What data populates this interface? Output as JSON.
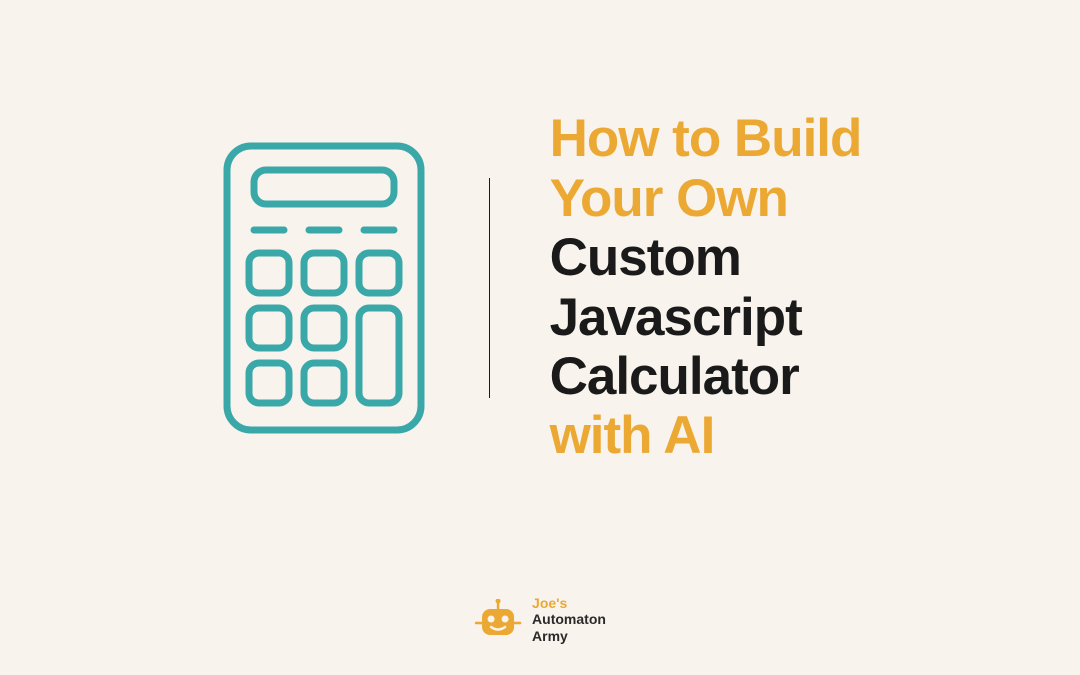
{
  "title": {
    "line1": "How to Build",
    "line2": "Your Own",
    "line3": " Custom",
    "line4": "Javascript",
    "line5": "Calculator",
    "line6": " with AI"
  },
  "logo": {
    "line1": "Joe's",
    "line2": "Automaton",
    "line3": "Army"
  },
  "colors": {
    "orange": "#eba833",
    "teal": "#3aa8a8",
    "black": "#1a1a1a",
    "background": "#f8f3ed"
  }
}
